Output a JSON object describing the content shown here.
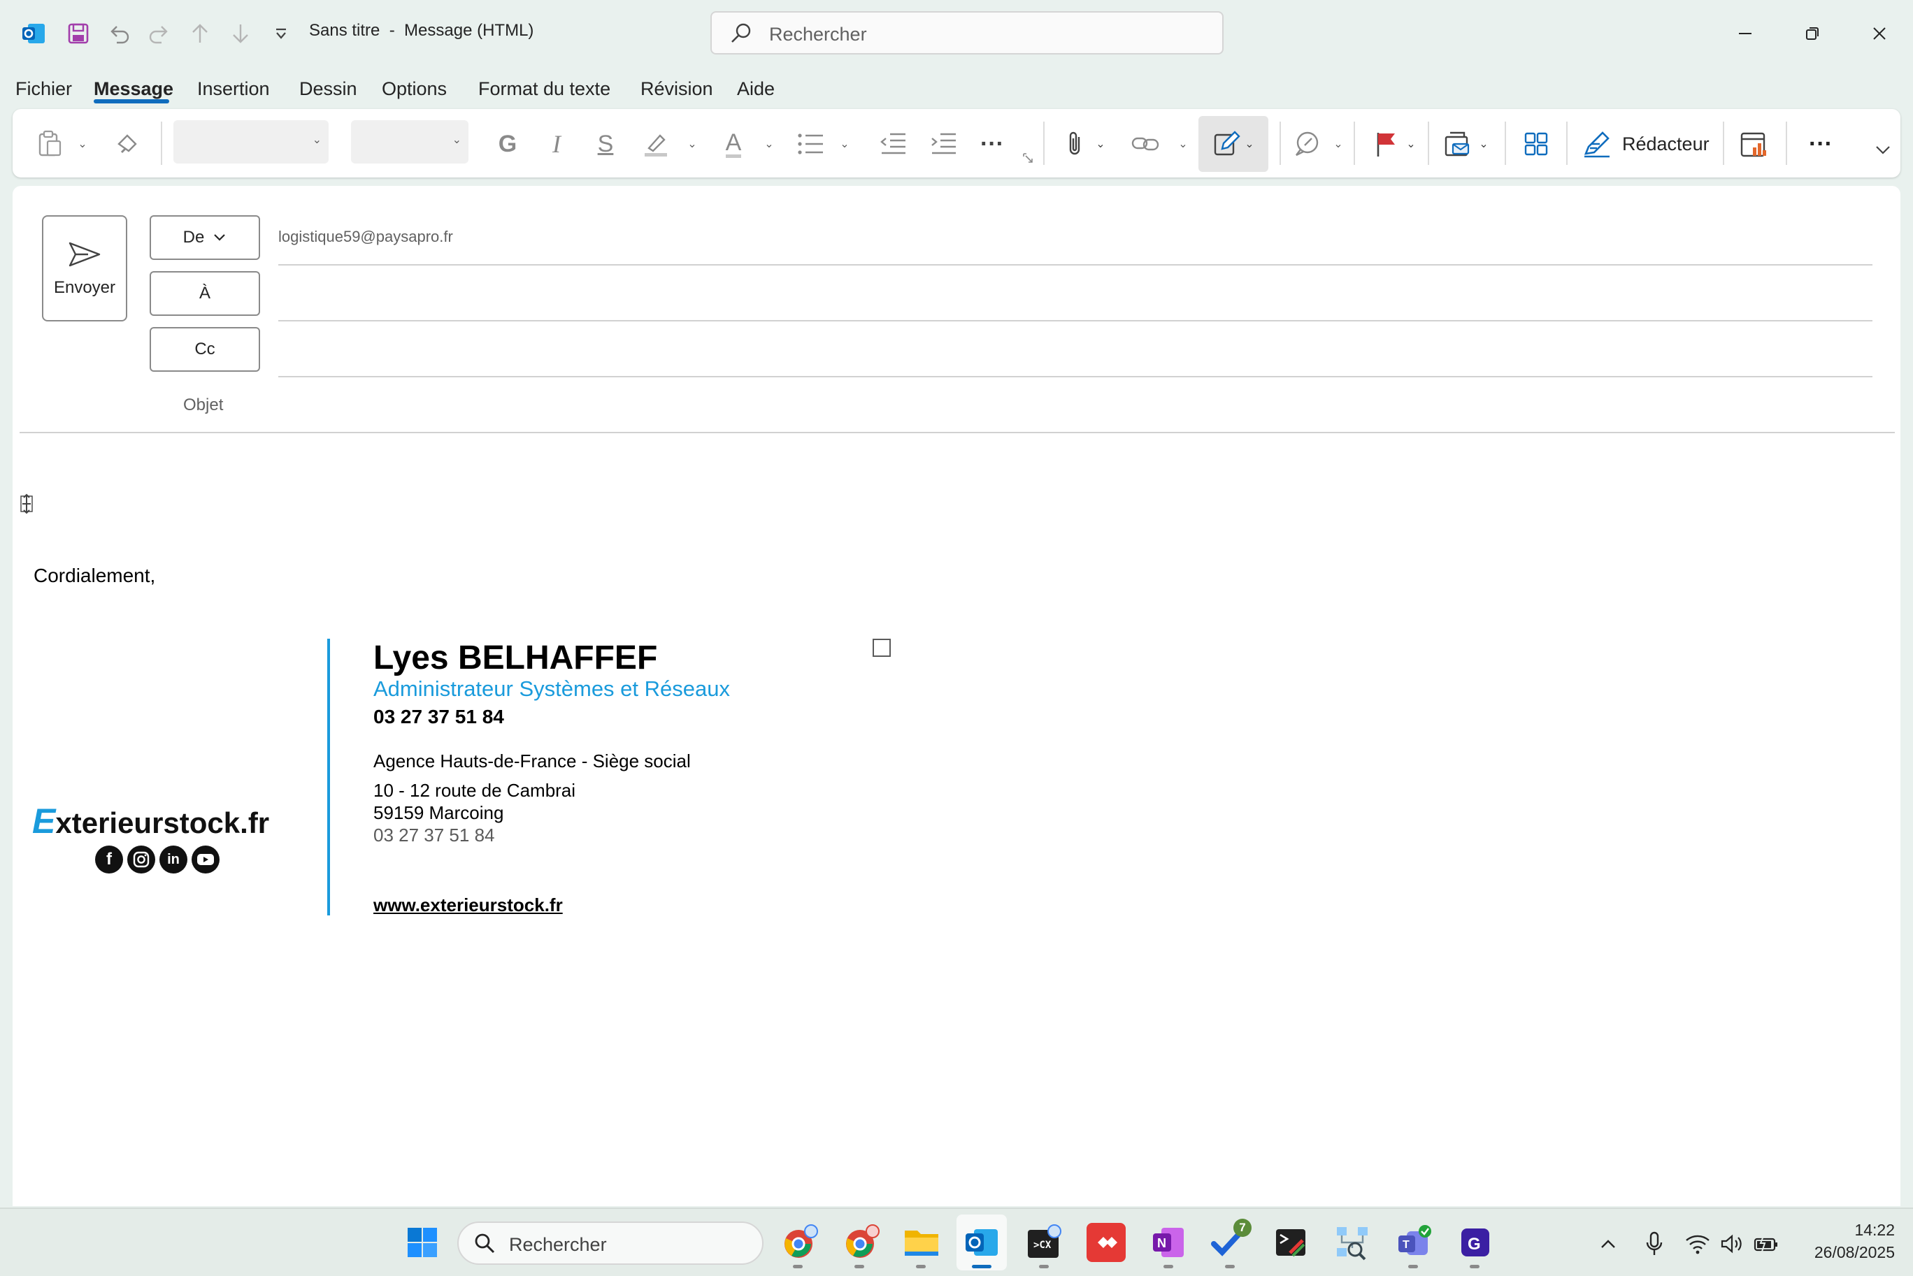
{
  "titlebar": {
    "title": "Sans titre  -  Message (HTML)",
    "search_placeholder": "Rechercher"
  },
  "menu": {
    "tabs": [
      "Fichier",
      "Message",
      "Insertion",
      "Dessin",
      "Options",
      "Format du texte",
      "Révision",
      "Aide"
    ],
    "active": "Message"
  },
  "ribbon": {
    "bold_label": "G",
    "italic_label": "I",
    "strike_label": "S",
    "font_color_label": "A",
    "more_label": "···",
    "editor_label": "Rédacteur"
  },
  "compose": {
    "send_label": "Envoyer",
    "from_label": "De",
    "from_value": "logistique59@paysapro.fr",
    "to_label": "À",
    "cc_label": "Cc",
    "subject_label": "Objet",
    "to_value": "",
    "cc_value": "",
    "subject_value": ""
  },
  "body": {
    "greeting": "Cordialement,",
    "logo_text": "Exterieurstock.fr",
    "logo_first_letter": "E",
    "logo_rest": "xterieurstock.fr",
    "social_icons": [
      "facebook-icon",
      "instagram-icon",
      "linkedin-icon",
      "youtube-icon"
    ],
    "name": "Lyes BELHAFFEF",
    "job_title": "Administrateur Systèmes et Réseaux",
    "phone_main": "03 27 37 51 84",
    "agency": "Agence Hauts-de-France - Siège social",
    "address_line1": "10 - 12 route de Cambrai",
    "address_line2": "59159 Marcoing",
    "phone_secondary": "03 27 37 51 84",
    "website": "www.exterieurstock.fr"
  },
  "taskbar": {
    "search_placeholder": "Rechercher",
    "time": "14:22",
    "date": "26/08/2025",
    "todo_badge": "7"
  },
  "colors": {
    "accent": "#0f6cbd",
    "signature_blue": "#1a9bdc",
    "window_bg": "#e9f1ee"
  }
}
